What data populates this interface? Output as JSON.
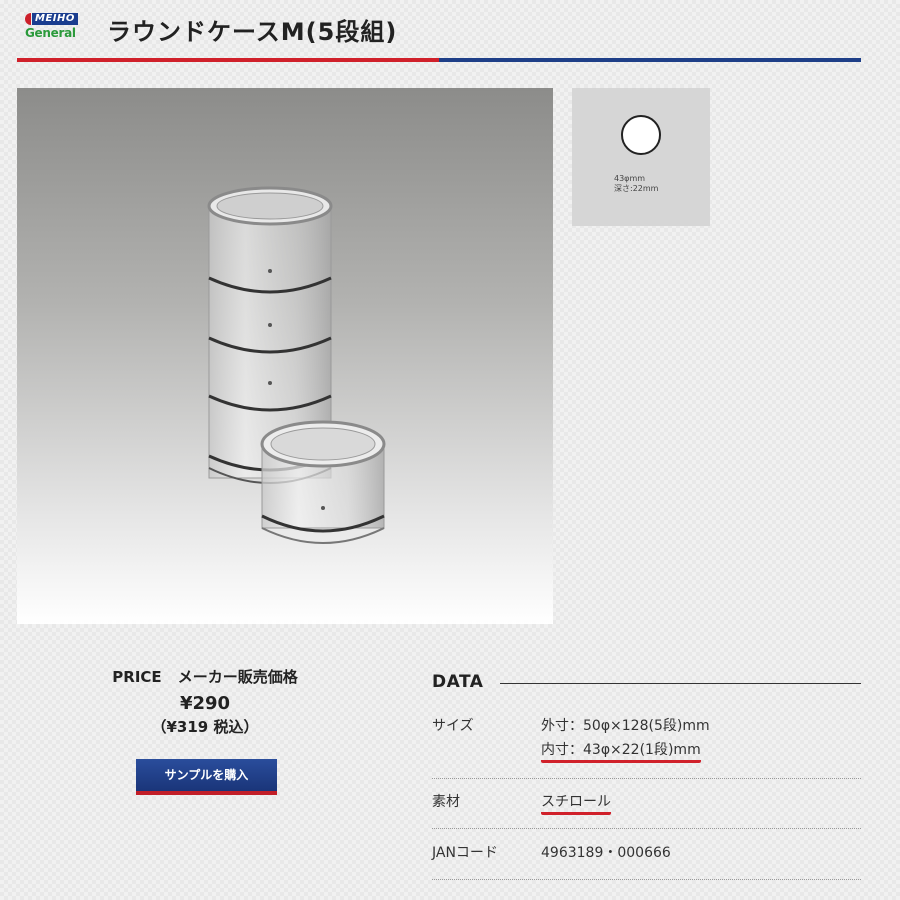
{
  "header": {
    "logo_top": "MEIHO",
    "logo_bottom": "General",
    "title": "ラウンドケースM(5段組)"
  },
  "thumbnail": {
    "spec_line1": "43φmm",
    "spec_line2": "深さ:22mm"
  },
  "price": {
    "heading_en": "PRICE",
    "heading_jp": "メーカー販売価格",
    "value": "¥290",
    "tax": "（¥319 税込）",
    "buy_label": "サンプルを購入"
  },
  "data": {
    "heading": "DATA",
    "rows": [
      {
        "label": "サイズ",
        "value1": "外寸：50φ×128(5段)mm",
        "value2": "内寸：43φ×22(1段)mm"
      },
      {
        "label": "素材",
        "value1": "スチロール"
      },
      {
        "label": "JANコード",
        "value1": "4963189・000666"
      }
    ]
  },
  "colors": {
    "accent_red": "#d0202a",
    "accent_blue": "#1e3f88"
  }
}
